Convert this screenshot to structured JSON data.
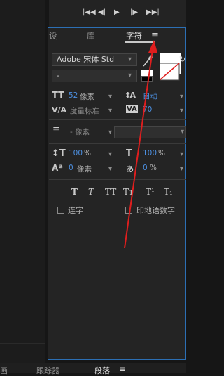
{
  "tabs": [
    "设",
    "库",
    "字符"
  ],
  "menu_icon": "≡",
  "font": {
    "family": "Adobe 宋体 Std",
    "style": "-"
  },
  "size": {
    "value": "52",
    "unit": "像素"
  },
  "leading": {
    "value": "自动"
  },
  "kerning": {
    "value": "度量标准"
  },
  "tracking": {
    "value": "70"
  },
  "stroke": {
    "value": "- 像素"
  },
  "vscale": {
    "value": "100",
    "unit": "%"
  },
  "hscale": {
    "value": "100",
    "unit": "%"
  },
  "baseline": {
    "value": "0",
    "unit": "像素"
  },
  "tsume": {
    "value": "0",
    "unit": "%"
  },
  "style_buttons": [
    "T",
    "T",
    "TT",
    "Tт",
    "T¹",
    "T₁"
  ],
  "options": {
    "ligatures": "连字",
    "hindi": "印地语数字"
  },
  "bottom_tabs": [
    "画",
    "跟踪器",
    "段落"
  ],
  "bottom_menu": "≡",
  "colors": {
    "panel_border": "#2c6fb4",
    "value_blue": "#4c8fe0",
    "arrow": "#e01e1e"
  }
}
